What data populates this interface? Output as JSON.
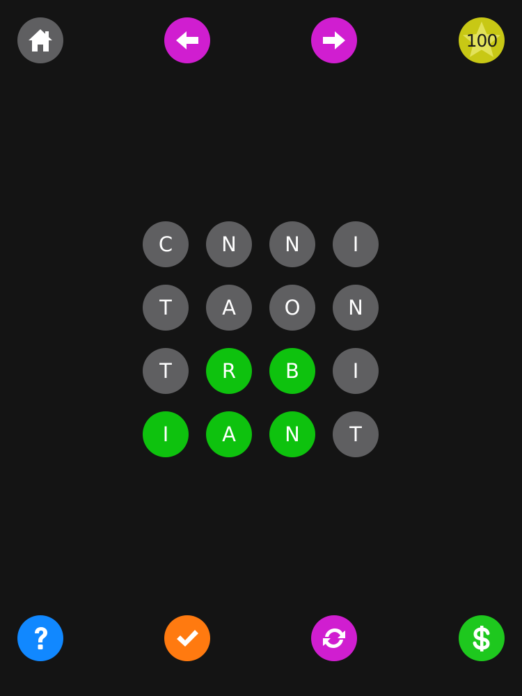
{
  "toolbar": {
    "home_icon": "home-icon",
    "prev_icon": "arrow-left-icon",
    "next_icon": "arrow-right-icon",
    "score": "100",
    "score_icon": "star-icon"
  },
  "board": {
    "tiles": [
      {
        "letter": "C",
        "selected": false
      },
      {
        "letter": "N",
        "selected": false
      },
      {
        "letter": "N",
        "selected": false
      },
      {
        "letter": "I",
        "selected": false
      },
      {
        "letter": "T",
        "selected": false
      },
      {
        "letter": "A",
        "selected": false
      },
      {
        "letter": "O",
        "selected": false
      },
      {
        "letter": "N",
        "selected": false
      },
      {
        "letter": "T",
        "selected": false
      },
      {
        "letter": "R",
        "selected": true
      },
      {
        "letter": "B",
        "selected": true
      },
      {
        "letter": "I",
        "selected": false
      },
      {
        "letter": "I",
        "selected": true
      },
      {
        "letter": "A",
        "selected": true
      },
      {
        "letter": "N",
        "selected": true
      },
      {
        "letter": "T",
        "selected": false
      }
    ]
  },
  "bottom_bar": {
    "help_icon": "question-mark-icon",
    "check_icon": "checkmark-icon",
    "shuffle_icon": "shuffle-icon",
    "buy_icon": "dollar-icon"
  },
  "colors": {
    "background": "#141414",
    "tile_default": "#5f5f61",
    "tile_selected": "#0ec20e",
    "magenta": "#d01ed0",
    "yellow": "#c8c815",
    "blue": "#1188ff",
    "orange": "#ff7a10",
    "green": "#1ec81e"
  }
}
